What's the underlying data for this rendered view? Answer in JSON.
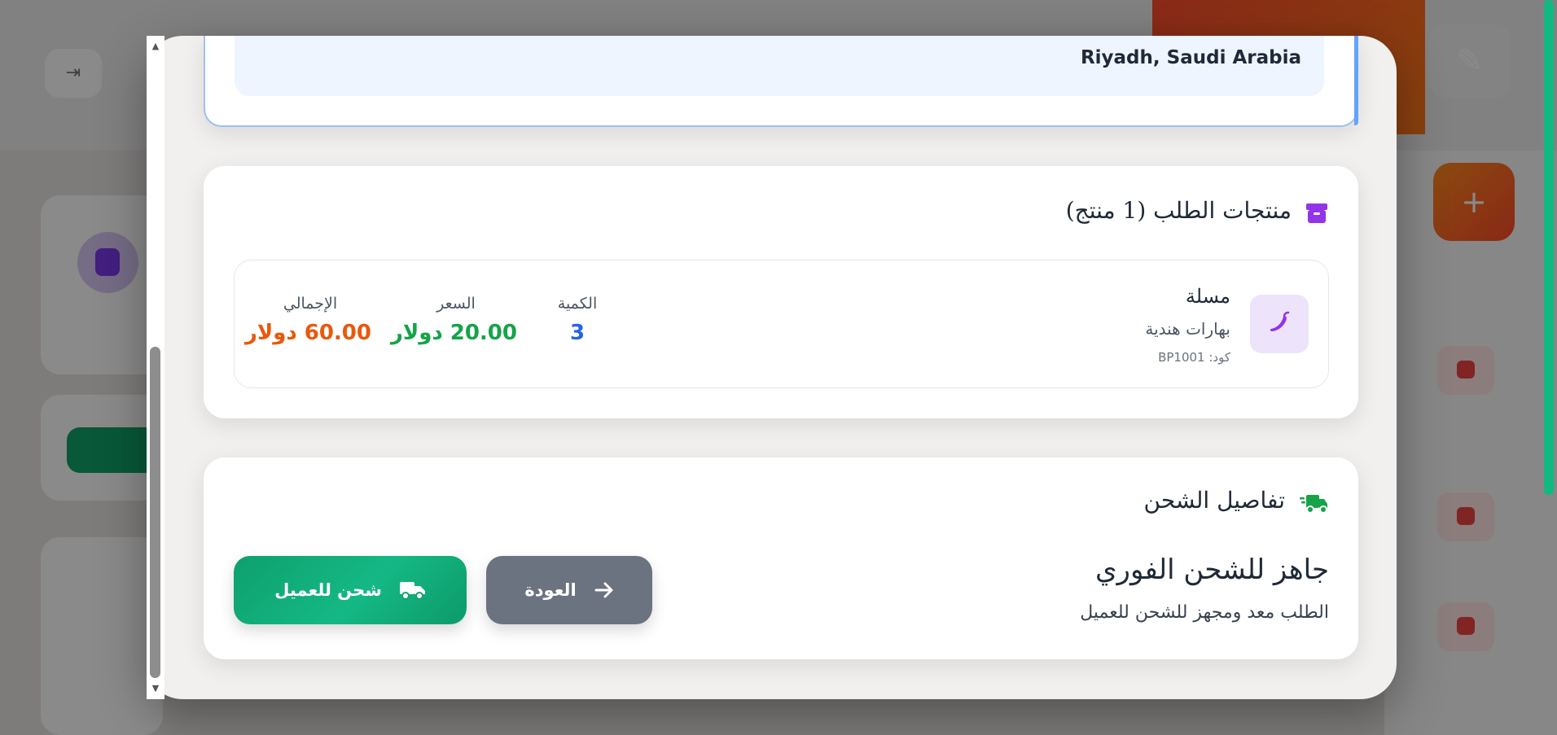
{
  "address": {
    "city_line": "Riyadh, Saudi Arabia"
  },
  "products": {
    "title": "منتجات الطلب (1 منتج)",
    "items": [
      {
        "name": "مسلة",
        "category": "بهارات هندية",
        "code": "كود: BP1001",
        "quantity_label": "الكمية",
        "quantity": "3",
        "price_label": "السعر",
        "price": "20.00 دولار",
        "total_label": "الإجمالي",
        "total": "60.00 دولار"
      }
    ]
  },
  "shipping": {
    "title": "تفاصيل الشحن",
    "headline": "جاهز للشحن الفوري",
    "description": "الطلب معد ومجهز للشحن للعميل",
    "ship_button": "شحن للعميل",
    "back_button": "العودة"
  },
  "colors": {
    "quantity": "#2563eb",
    "price": "#16a34a",
    "total": "#ea580c",
    "box_icon": "#9333ea",
    "truck_icon": "#16a34a"
  },
  "icons": {
    "products": "box-icon",
    "product_thumb": "chili-pepper-icon",
    "shipping": "fast-truck-icon",
    "ship_button": "truck-icon",
    "back_button": "arrow-right-icon"
  }
}
